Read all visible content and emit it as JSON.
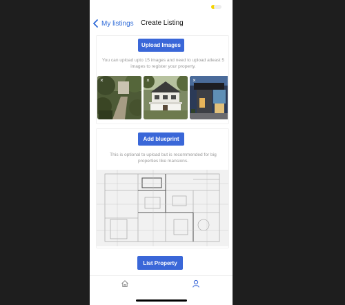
{
  "nav": {
    "back_label": "My listings",
    "title": "Create Listing"
  },
  "upload": {
    "button_label": "Upload Images",
    "hint": "You can upload upto 15 images and need to upload atleast 5 images to register your property.",
    "remove_label": "×"
  },
  "blueprint": {
    "button_label": "Add blueprint",
    "hint": "This is optional to upload but is recommended for big properties like mansions."
  },
  "submit": {
    "button_label": "List Property"
  },
  "tabs": [
    {
      "name": "home",
      "icon": "home-icon"
    },
    {
      "name": "profile",
      "icon": "person-icon"
    }
  ],
  "colors": {
    "accent": "#3a67d8",
    "link": "#2f6bd8"
  }
}
